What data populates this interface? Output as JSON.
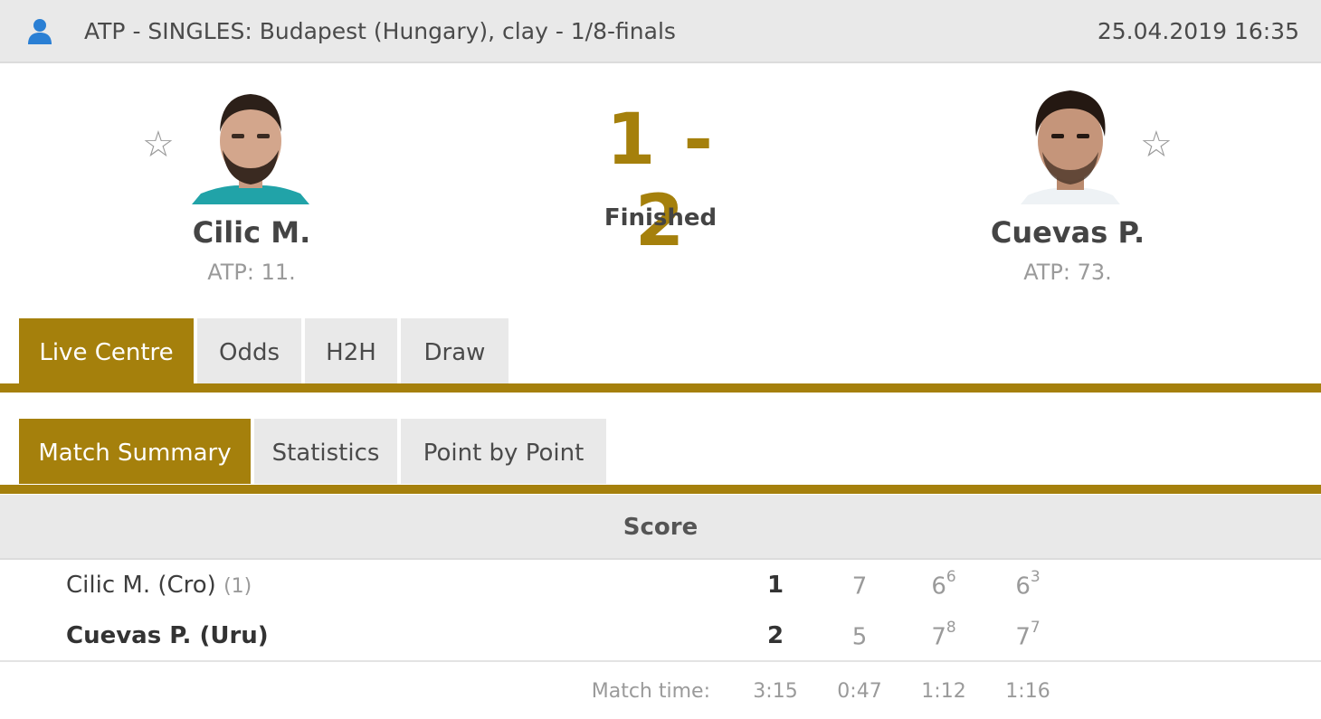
{
  "header": {
    "event": "ATP - SINGLES: Budapest (Hungary), clay - 1/8-finals",
    "datetime": "25.04.2019 16:35"
  },
  "colors": {
    "accent": "#a5800c",
    "header_bg": "#e9e9e9",
    "user_icon": "#2a7fd4"
  },
  "home": {
    "name": "Cilic M.",
    "rank": "ATP: 11.",
    "favorite_icon": "star-outline-icon"
  },
  "away": {
    "name": "Cuevas P.",
    "rank": "ATP: 73.",
    "favorite_icon": "star-outline-icon"
  },
  "match": {
    "score": "1 - 2",
    "status": "Finished"
  },
  "main_tabs": [
    "Live Centre",
    "Odds",
    "H2H",
    "Draw"
  ],
  "sub_tabs": [
    "Match Summary",
    "Statistics",
    "Point by Point"
  ],
  "summary": {
    "heading": "Score",
    "rows": [
      {
        "name": "Cilic M. (Cro)",
        "seed": "(1)",
        "total": "1",
        "sets": [
          {
            "games": "7",
            "tb": ""
          },
          {
            "games": "6",
            "tb": "6"
          },
          {
            "games": "6",
            "tb": "3"
          }
        ]
      },
      {
        "name": "Cuevas P. (Uru)",
        "seed": "",
        "total": "2",
        "sets": [
          {
            "games": "5",
            "tb": ""
          },
          {
            "games": "7",
            "tb": "8"
          },
          {
            "games": "7",
            "tb": "7"
          }
        ]
      }
    ],
    "match_time_label": "Match time:",
    "match_times": [
      "3:15",
      "0:47",
      "1:12",
      "1:16"
    ]
  }
}
